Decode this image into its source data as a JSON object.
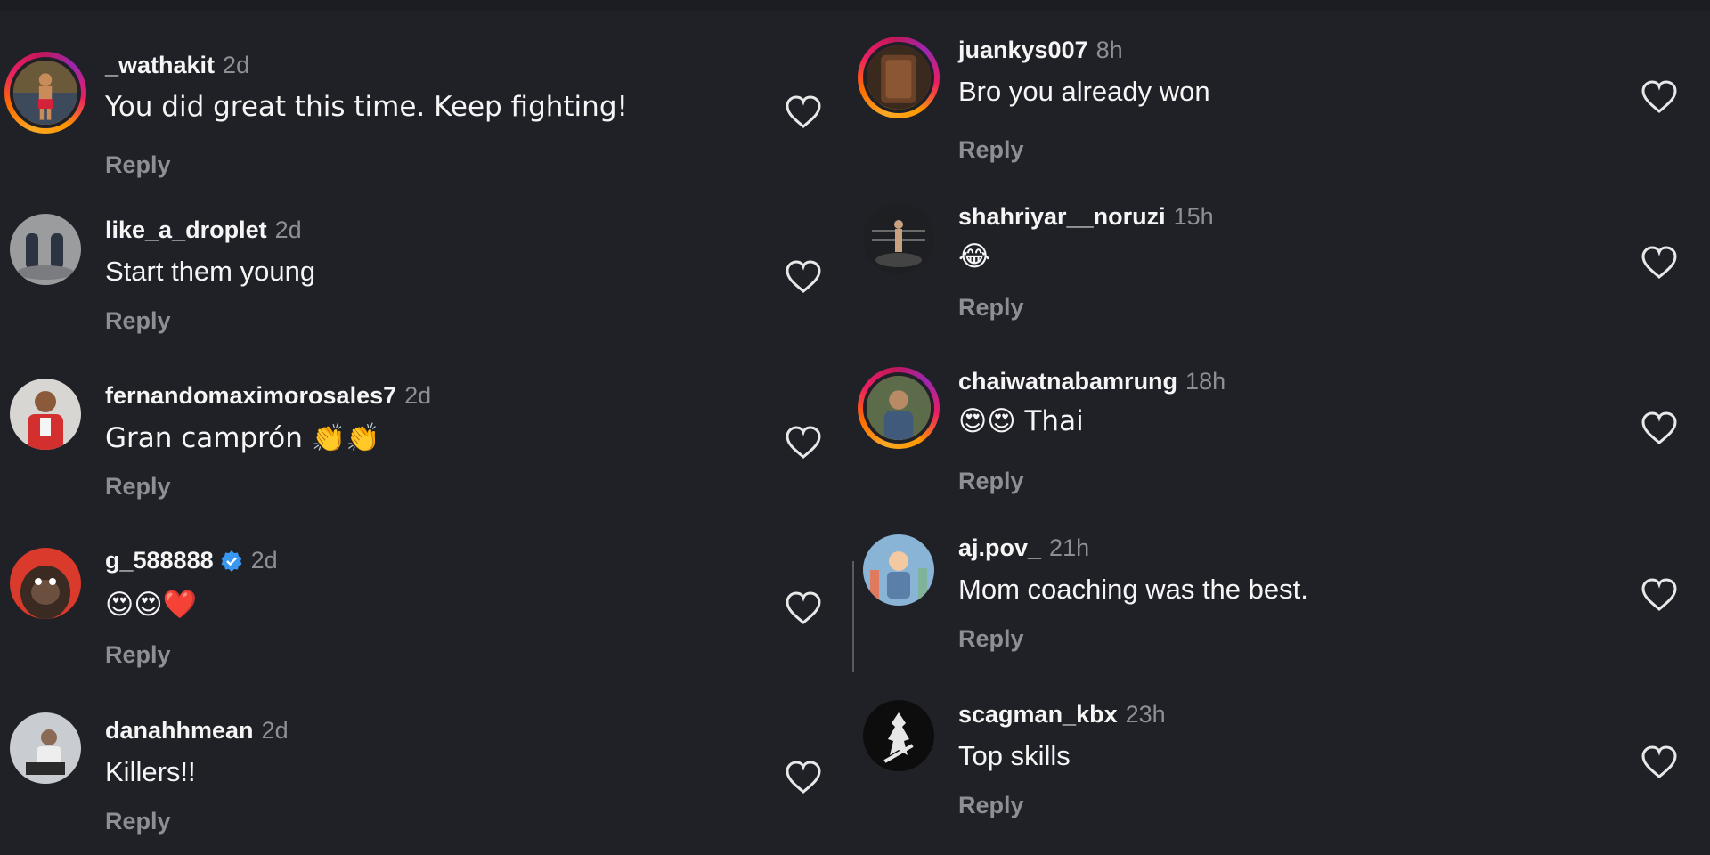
{
  "left_comments": [
    {
      "username": "_wathakit",
      "time": "2d",
      "text": "You did great this time. Keep fighting!",
      "reply": "Reply",
      "avatar": "boxer-avatar",
      "story": true
    },
    {
      "username": "like_a_droplet",
      "time": "2d",
      "text": "Start them young",
      "reply": "Reply",
      "avatar": "shoes-avatar",
      "story": false
    },
    {
      "username": "fernandomaximorosales7",
      "time": "2d",
      "text": "Gran camprón 👏👏",
      "reply": "Reply",
      "avatar": "kid-avatar",
      "story": false
    },
    {
      "username": "g_588888",
      "time": "2d",
      "text": "😍😍❤️",
      "reply": "Reply",
      "avatar": "gorilla-avatar",
      "story": false,
      "verified": true
    },
    {
      "username": "danahhmean",
      "time": "2d",
      "text": "Killers!!",
      "reply": "Reply",
      "avatar": "person-sitting-avatar",
      "story": false
    }
  ],
  "right_comments": [
    {
      "username": "juankys007",
      "time": "8h",
      "text": "Bro you already won",
      "reply": "Reply",
      "avatar": "wood-avatar",
      "story": true
    },
    {
      "username": "shahriyar__noruzi",
      "time": "15h",
      "text": "😂",
      "reply": "Reply",
      "avatar": "ring-avatar",
      "story": false
    },
    {
      "username": "chaiwatnabamrung",
      "time": "18h",
      "text": "😍😍 Thai",
      "reply": "Reply",
      "avatar": "man-avatar",
      "story": true
    },
    {
      "username": "aj.pov_",
      "time": "21h",
      "text": "Mom coaching was the best.",
      "reply": "Reply",
      "avatar": "cartoon-avatar",
      "story": false
    },
    {
      "username": "scagman_kbx",
      "time": "23h",
      "text": "Top skills",
      "reply": "Reply",
      "avatar": "logo-avatar",
      "story": false
    }
  ],
  "colors": {
    "background": "#202127",
    "muted": "#8e8f96",
    "verified": "#3897f0"
  }
}
